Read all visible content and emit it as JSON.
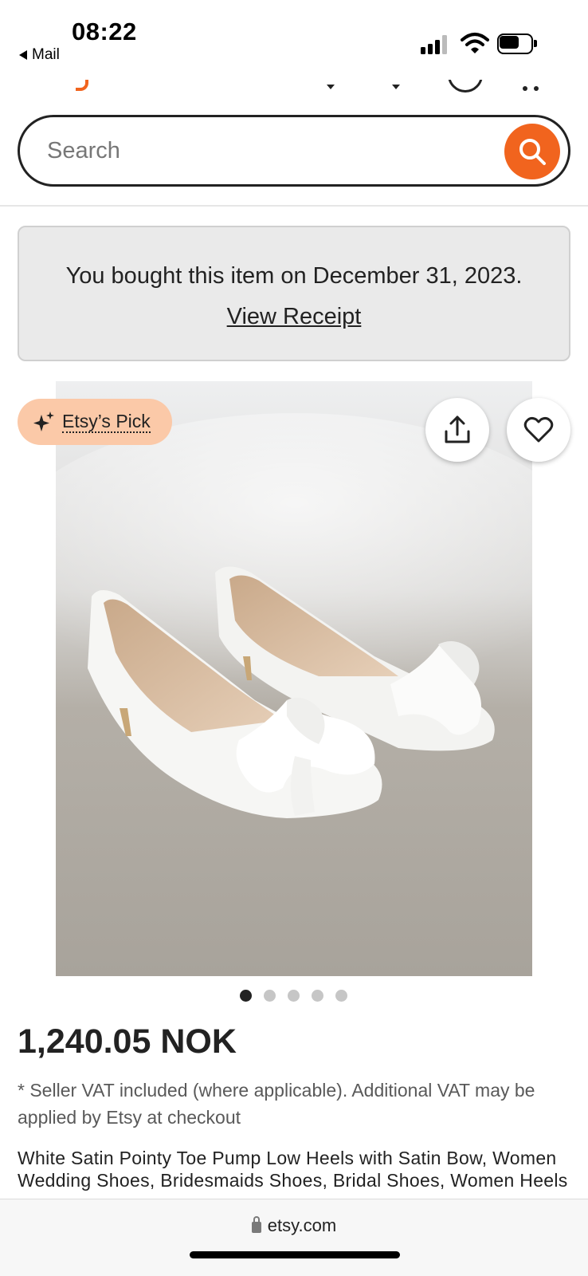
{
  "status_bar": {
    "time": "08:22",
    "back_label": "Mail"
  },
  "search": {
    "placeholder": "Search",
    "button_icon": "search-icon"
  },
  "purchase_notice": {
    "text": "You bought this item on December 31, 2023.",
    "link_label": "View Receipt"
  },
  "listing": {
    "badge_label": "Etsy’s Pick",
    "badge_icon": "sparkle-icon",
    "share_icon": "share-icon",
    "favorite_icon": "heart-icon",
    "image_count": 5,
    "active_image": 1,
    "price": "1,240.05 NOK",
    "vat_note": "* Seller VAT included (where applicable). Additional VAT may be applied by Etsy at checkout",
    "title": "White Satin Pointy Toe Pump Low Heels with Satin Bow, Women Wedding Shoes, Bridesmaids Shoes, Bridal Shoes, Women Heels"
  },
  "browser": {
    "url": "etsy.com"
  },
  "colors": {
    "accent": "#F1641E",
    "badge_bg": "#FBC9A8",
    "notice_bg": "#EAEAEA",
    "text": "#222222"
  }
}
